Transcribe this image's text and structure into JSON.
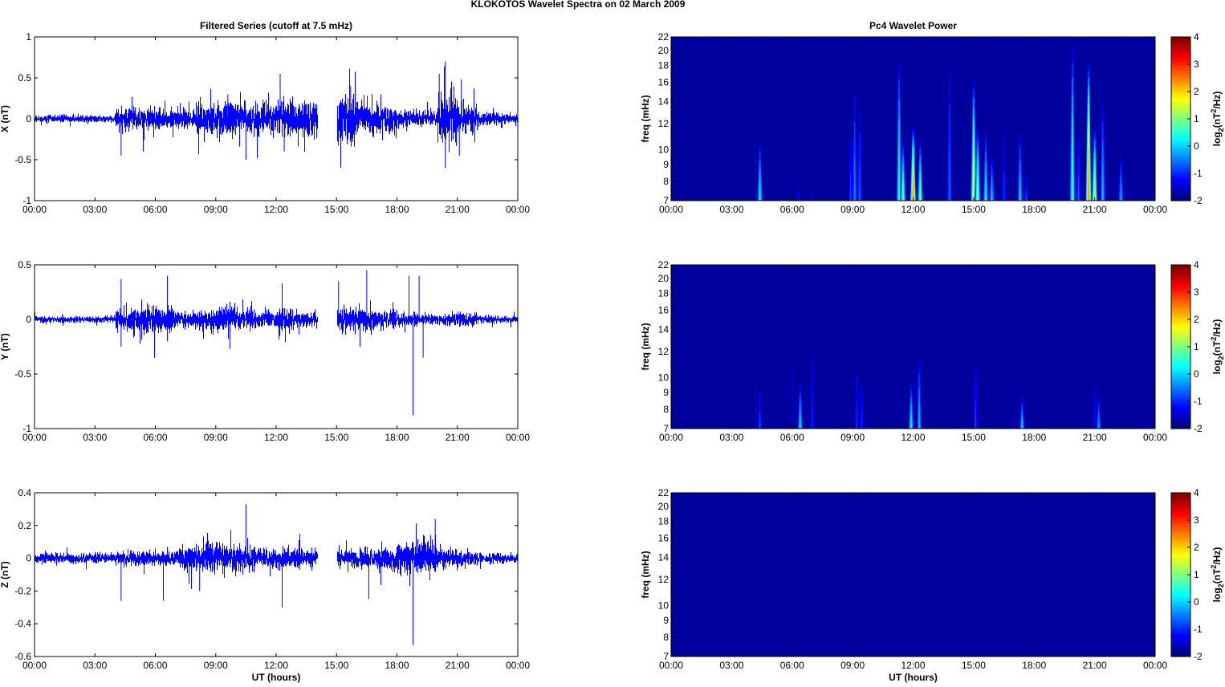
{
  "title": "KLOKOTOS Wavelet Spectra on 02 March     2009",
  "chart_data": [
    {
      "type": "line",
      "title": "Filtered Series (cutoff at 7.5 mHz)",
      "ylabel": "X (nT)",
      "xlabel": "",
      "ylim": [
        -1,
        1
      ],
      "yticks": [
        "1",
        "0.5",
        "0",
        "-0.5",
        "-1"
      ],
      "ytick_values": [
        1,
        0.5,
        0,
        -0.5,
        -1
      ],
      "xticks": [
        "00:00",
        "03:00",
        "06:00",
        "09:00",
        "12:00",
        "15:00",
        "18:00",
        "21:00",
        "00:00"
      ],
      "xlim_hours": [
        0,
        24
      ],
      "color": "#0000ff",
      "gap_hours": [
        14.05,
        15.0
      ],
      "envelope_hourly_nT": [
        0.03,
        0.03,
        0.03,
        0.03,
        0.1,
        0.09,
        0.08,
        0.08,
        0.13,
        0.15,
        0.11,
        0.12,
        0.14,
        0.15,
        0.12,
        0.2,
        0.13,
        0.12,
        0.08,
        0.06,
        0.2,
        0.12,
        0.05,
        0.04
      ],
      "spikes": [
        [
          4.3,
          -0.45
        ],
        [
          10.5,
          -0.5
        ],
        [
          12.2,
          0.55
        ],
        [
          12.4,
          -0.4
        ],
        [
          9.6,
          0.3
        ],
        [
          15.7,
          0.4
        ],
        [
          17.2,
          0.3
        ],
        [
          20.1,
          0.55
        ],
        [
          20.4,
          0.7
        ],
        [
          20.4,
          -0.6
        ],
        [
          21.2,
          0.48
        ],
        [
          21.1,
          -0.45
        ],
        [
          5.4,
          -0.4
        ]
      ]
    },
    {
      "type": "line",
      "ylabel": "Y (nT)",
      "xlabel": "",
      "ylim": [
        -1,
        0.5
      ],
      "yticks": [
        "0.5",
        "0",
        "-0.5",
        "-1"
      ],
      "ytick_values": [
        0.5,
        0,
        -0.5,
        -1
      ],
      "xticks": [
        "00:00",
        "03:00",
        "06:00",
        "09:00",
        "12:00",
        "15:00",
        "18:00",
        "21:00",
        "00:00"
      ],
      "xlim_hours": [
        0,
        24
      ],
      "color": "#0000ff",
      "gap_hours": [
        14.05,
        15.0
      ],
      "envelope_hourly_nT": [
        0.02,
        0.02,
        0.02,
        0.02,
        0.07,
        0.08,
        0.08,
        0.05,
        0.06,
        0.08,
        0.06,
        0.05,
        0.07,
        0.05,
        0.03,
        0.08,
        0.07,
        0.06,
        0.04,
        0.03,
        0.04,
        0.05,
        0.03,
        0.02
      ],
      "spikes": [
        [
          4.3,
          0.37
        ],
        [
          4.3,
          -0.25
        ],
        [
          6.6,
          0.4
        ],
        [
          6.6,
          -0.2
        ],
        [
          9.7,
          -0.27
        ],
        [
          12.3,
          0.33
        ],
        [
          15.1,
          0.35
        ],
        [
          16.5,
          0.45
        ],
        [
          18.6,
          0.4
        ],
        [
          18.8,
          -0.88
        ],
        [
          19.1,
          0.4
        ],
        [
          19.3,
          -0.35
        ]
      ]
    },
    {
      "type": "line",
      "ylabel": "Z (nT)",
      "xlabel": "UT (hours)",
      "ylim": [
        -0.6,
        0.4
      ],
      "yticks": [
        "0.4",
        "0.2",
        "0",
        "-0.2",
        "-0.4",
        "-0.6"
      ],
      "ytick_values": [
        0.4,
        0.2,
        0,
        -0.2,
        -0.4,
        -0.6
      ],
      "xticks": [
        "00:00",
        "03:00",
        "06:00",
        "09:00",
        "12:00",
        "15:00",
        "18:00",
        "21:00",
        "00:00"
      ],
      "xlim_hours": [
        0,
        24
      ],
      "color": "#0000ff",
      "gap_hours": [
        14.05,
        15.0
      ],
      "envelope_hourly_nT": [
        0.02,
        0.02,
        0.02,
        0.02,
        0.03,
        0.03,
        0.03,
        0.05,
        0.07,
        0.06,
        0.05,
        0.04,
        0.04,
        0.04,
        0.03,
        0.04,
        0.04,
        0.05,
        0.07,
        0.07,
        0.04,
        0.03,
        0.02,
        0.02
      ],
      "spikes": [
        [
          10.5,
          0.33
        ],
        [
          19.9,
          0.24
        ],
        [
          18.8,
          -0.53
        ],
        [
          12.3,
          -0.3
        ],
        [
          4.3,
          -0.26
        ],
        [
          6.4,
          -0.26
        ],
        [
          16.6,
          -0.25
        ],
        [
          8.2,
          -0.2
        ]
      ]
    },
    {
      "type": "heatmap",
      "title": "Pc4 Wavelet Power",
      "ylabel": "freq (mHz)",
      "xlabel": "",
      "yscale": "log",
      "ylim": [
        7,
        22
      ],
      "yticks": [
        "22",
        "20",
        "18",
        "16",
        "14",
        "12",
        "10",
        "9",
        "8",
        "7"
      ],
      "ytick_values": [
        22,
        20,
        18,
        16,
        14,
        12,
        10,
        9,
        8,
        7
      ],
      "xticks": [
        "00:00",
        "03:00",
        "06:00",
        "09:00",
        "12:00",
        "15:00",
        "18:00",
        "21:00",
        "00:00"
      ],
      "xlim_hours": [
        0,
        24
      ],
      "colorbar": {
        "label": "log2(nT2/Hz)",
        "label_main": "log",
        "label_sub": "2",
        "label_mid": "(nT",
        "label_sup": "2",
        "label_end": "/Hz)",
        "range": [
          -2,
          4
        ],
        "ticks": [
          "4",
          "3",
          "2",
          "1",
          "0",
          "-1",
          "-2"
        ],
        "tick_values": [
          4,
          3,
          2,
          1,
          0,
          -1,
          -2
        ]
      },
      "background_value": -1.8,
      "bursts": [
        [
          4.2,
          22,
          -1.2
        ],
        [
          4.4,
          11,
          0.6
        ],
        [
          6.3,
          10,
          -1.1
        ],
        [
          7.0,
          10,
          -1.2
        ],
        [
          8.9,
          13,
          -0.6
        ],
        [
          9.1,
          17,
          -0.2
        ],
        [
          9.35,
          15,
          -0.5
        ],
        [
          11.3,
          20,
          0.8
        ],
        [
          11.5,
          11,
          1.2
        ],
        [
          12.0,
          12,
          3.0
        ],
        [
          12.35,
          11,
          1.3
        ],
        [
          13.8,
          20,
          -0.4
        ],
        [
          15.0,
          17,
          2.0
        ],
        [
          15.2,
          12,
          1.5
        ],
        [
          15.6,
          12,
          0.6
        ],
        [
          15.9,
          10,
          0.3
        ],
        [
          16.5,
          13,
          -0.8
        ],
        [
          17.3,
          12,
          0.3
        ],
        [
          17.6,
          9,
          -0.6
        ],
        [
          19.9,
          22,
          1.0
        ],
        [
          20.2,
          12,
          -0.5
        ],
        [
          20.7,
          19,
          3.0
        ],
        [
          21.0,
          12,
          2.0
        ],
        [
          21.4,
          15,
          0.2
        ],
        [
          22.3,
          10,
          0.0
        ]
      ]
    },
    {
      "type": "heatmap",
      "ylabel": "freq (mHz)",
      "xlabel": "",
      "yscale": "log",
      "ylim": [
        7,
        22
      ],
      "yticks": [
        "22",
        "20",
        "18",
        "16",
        "14",
        "12",
        "10",
        "9",
        "8",
        "7"
      ],
      "ytick_values": [
        22,
        20,
        18,
        16,
        14,
        12,
        10,
        9,
        8,
        7
      ],
      "xticks": [
        "00:00",
        "03:00",
        "06:00",
        "09:00",
        "12:00",
        "15:00",
        "18:00",
        "21:00",
        "00:00"
      ],
      "xlim_hours": [
        0,
        24
      ],
      "colorbar": {
        "label": "log2(nT2/Hz)",
        "label_main": "log",
        "label_sub": "2",
        "label_mid": "(nT",
        "label_sup": "2",
        "label_end": "/Hz)",
        "range": [
          -2,
          4
        ],
        "ticks": [
          "4",
          "3",
          "2",
          "1",
          "0",
          "-1",
          "-2"
        ],
        "tick_values": [
          4,
          3,
          2,
          1,
          0,
          -1,
          -2
        ]
      },
      "background_value": -1.8,
      "bursts": [
        [
          4.2,
          22,
          -1.4
        ],
        [
          4.4,
          10,
          -0.6
        ],
        [
          6.0,
          22,
          -1.4
        ],
        [
          6.4,
          10,
          0.4
        ],
        [
          7.0,
          14,
          -0.9
        ],
        [
          9.2,
          12,
          -0.8
        ],
        [
          9.45,
          11,
          -0.8
        ],
        [
          11.9,
          10,
          0.6
        ],
        [
          12.3,
          12,
          0.2
        ],
        [
          12.2,
          22,
          -1.4
        ],
        [
          15.1,
          13,
          -0.6
        ],
        [
          17.0,
          22,
          -1.5
        ],
        [
          17.4,
          9,
          0.3
        ],
        [
          21.2,
          9,
          0.0
        ],
        [
          21.0,
          11,
          -1.0
        ]
      ]
    },
    {
      "type": "heatmap",
      "ylabel": "freq (mHz)",
      "xlabel": "UT (hours)",
      "yscale": "log",
      "ylim": [
        7,
        22
      ],
      "yticks": [
        "22",
        "20",
        "18",
        "16",
        "14",
        "12",
        "10",
        "9",
        "8",
        "7"
      ],
      "ytick_values": [
        22,
        20,
        18,
        16,
        14,
        12,
        10,
        9,
        8,
        7
      ],
      "xticks": [
        "00:00",
        "03:00",
        "06:00",
        "09:00",
        "12:00",
        "15:00",
        "18:00",
        "21:00",
        "00:00"
      ],
      "xlim_hours": [
        0,
        24
      ],
      "colorbar": {
        "label": "log2(nT2/Hz)",
        "label_main": "log",
        "label_sub": "2",
        "label_mid": "(nT",
        "label_sup": "2",
        "label_end": "/Hz)",
        "range": [
          -2,
          4
        ],
        "ticks": [
          "4",
          "3",
          "2",
          "1",
          "0",
          "-1",
          "-2"
        ],
        "tick_values": [
          4,
          3,
          2,
          1,
          0,
          -1,
          -2
        ]
      },
      "background_value": -1.8,
      "bursts": [
        [
          15.6,
          10,
          -1.6
        ]
      ]
    }
  ]
}
